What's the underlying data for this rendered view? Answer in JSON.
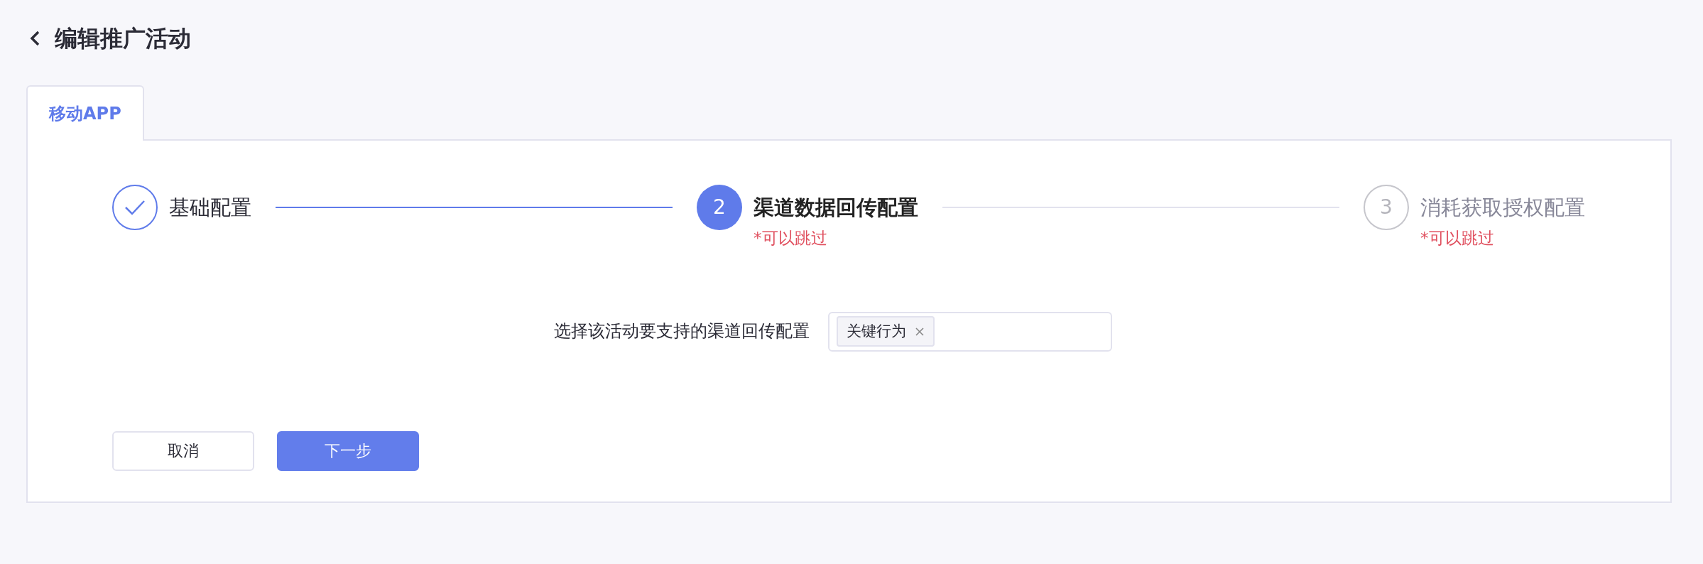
{
  "page": {
    "title": "编辑推广活动"
  },
  "tabs": [
    {
      "label": "移动APP",
      "selected": true
    }
  ],
  "steps": [
    {
      "title": "基础配置",
      "completed": true,
      "current": false
    },
    {
      "number": "2",
      "title": "渠道数据回传配置",
      "completed": false,
      "current": true,
      "note": "*可以跳过"
    },
    {
      "number": "3",
      "title": "消耗获取授权配置",
      "completed": false,
      "current": false,
      "note": "*可以跳过"
    }
  ],
  "form": {
    "label": "选择该活动要支持的渠道回传配置",
    "tags": [
      "关键行为"
    ]
  },
  "buttons": [
    {
      "label": "取消",
      "kind": "secondary"
    },
    {
      "label": "下一步",
      "kind": "primary"
    }
  ]
}
